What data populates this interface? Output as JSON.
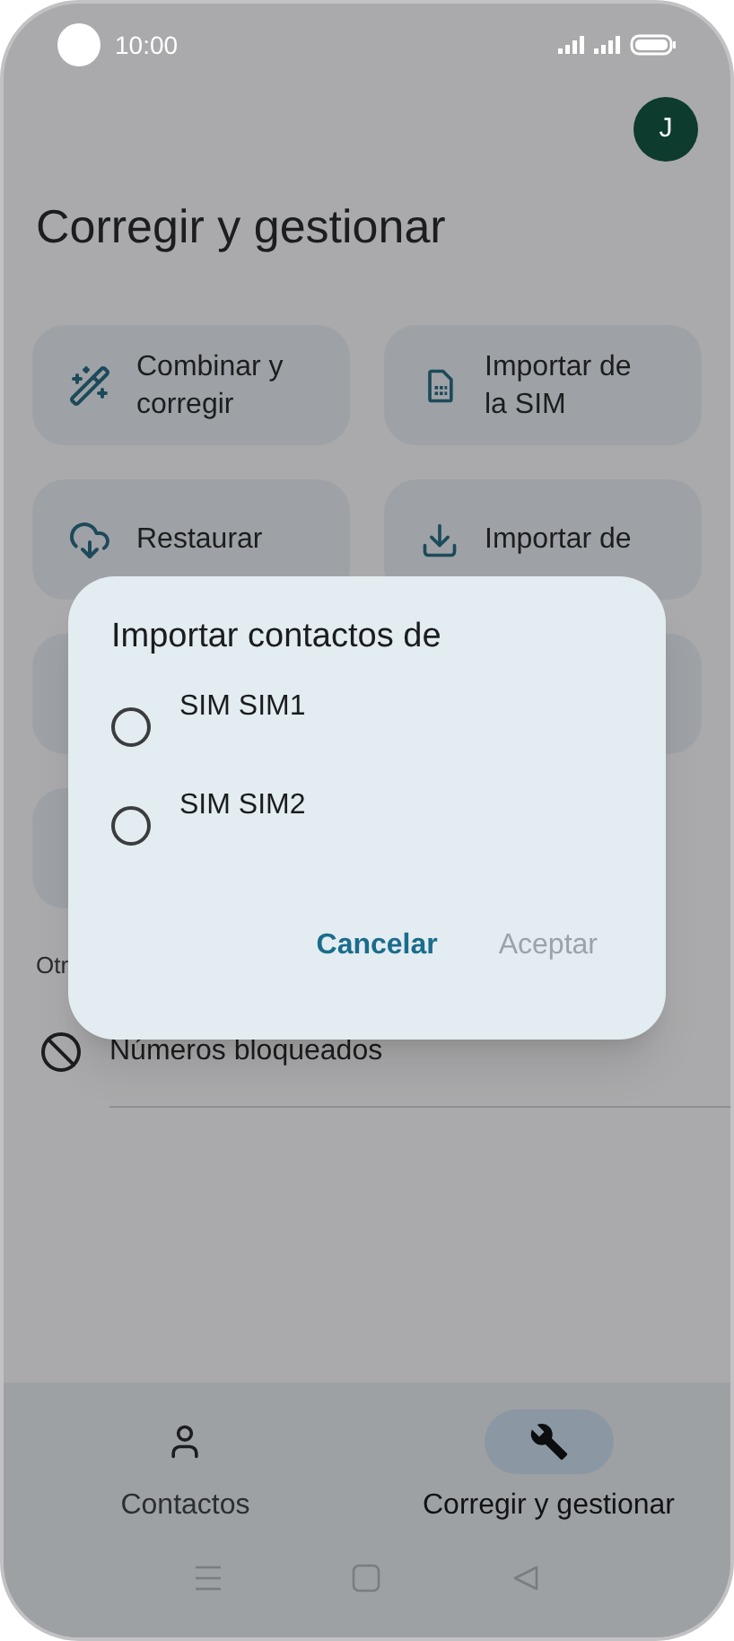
{
  "status_bar": {
    "time": "10:00"
  },
  "avatar": {
    "initial": "J"
  },
  "title": "Corregir y gestionar",
  "actions": [
    {
      "kind": "card",
      "label": "Combinar y corregir"
    },
    {
      "kind": "card",
      "label": "Importar de la SIM"
    },
    {
      "kind": "card",
      "label": "Restaurar"
    },
    {
      "kind": "card",
      "label": "Importar de"
    },
    {
      "kind": "covered"
    },
    {
      "kind": "covered"
    },
    {
      "kind": "covered"
    }
  ],
  "section_label": "Otr",
  "list_items": [
    {
      "label": "Números bloqueados"
    }
  ],
  "dialog": {
    "title": "Importar contactos de",
    "options": [
      {
        "label": "SIM SIM1",
        "selected": false
      },
      {
        "label": "SIM SIM2",
        "selected": false
      }
    ],
    "buttons": [
      {
        "label": "Cancelar",
        "disabled": false
      },
      {
        "label": "Aceptar",
        "disabled": true
      }
    ]
  },
  "bottom_nav": [
    {
      "label": "Contactos",
      "selected": false
    },
    {
      "label": "Corregir y gestionar",
      "selected": true
    }
  ]
}
